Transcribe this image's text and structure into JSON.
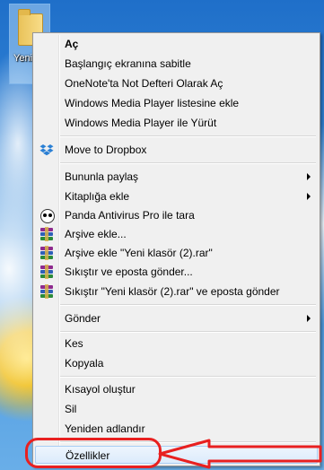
{
  "desktop": {
    "folder_icon": {
      "icon": "folder-icon",
      "label": "Yeni"
    }
  },
  "menu": {
    "items": [
      {
        "id": "open",
        "label": "Aç",
        "bold": true
      },
      {
        "id": "pin-start",
        "label": "Başlangıç ekranına sabitle"
      },
      {
        "id": "onenote",
        "label": "OneNote'ta Not Defteri Olarak Aç"
      },
      {
        "id": "wmp-list",
        "label": "Windows Media Player listesine ekle"
      },
      {
        "id": "wmp-play",
        "label": "Windows Media Player ile Yürüt"
      },
      {
        "id": "dropbox",
        "label": "Move to Dropbox",
        "icon": "dropbox-icon"
      },
      {
        "id": "share",
        "label": "Bununla paylaş",
        "submenu": true
      },
      {
        "id": "library",
        "label": "Kitaplığa ekle",
        "submenu": true
      },
      {
        "id": "panda",
        "label": "Panda Antivirus Pro ile tara",
        "icon": "panda-icon"
      },
      {
        "id": "archive-add",
        "label": "Arşive ekle...",
        "icon": "winrar-icon"
      },
      {
        "id": "archive-add-named",
        "label": "Arşive ekle \"Yeni klasör (2).rar\"",
        "icon": "winrar-icon"
      },
      {
        "id": "compress-email",
        "label": "Sıkıştır ve eposta gönder...",
        "icon": "winrar-icon"
      },
      {
        "id": "compress-email-named",
        "label": "Sıkıştır \"Yeni klasör (2).rar\" ve eposta gönder",
        "icon": "winrar-icon"
      },
      {
        "id": "send-to",
        "label": "Gönder",
        "submenu": true
      },
      {
        "id": "cut",
        "label": "Kes"
      },
      {
        "id": "copy",
        "label": "Kopyala"
      },
      {
        "id": "shortcut",
        "label": "Kısayol oluştur"
      },
      {
        "id": "delete",
        "label": "Sil"
      },
      {
        "id": "rename",
        "label": "Yeniden adlandır"
      },
      {
        "id": "properties",
        "label": "Özellikler",
        "highlighted": true
      }
    ]
  },
  "annotation": {
    "color": "#e82020",
    "shape": "ellipse-with-arrow",
    "target": "properties"
  },
  "colors": {
    "menu_bg": "#f0f0f0",
    "highlight_bg": "#dcebfc",
    "highlight_border": "#a8cdf4"
  }
}
